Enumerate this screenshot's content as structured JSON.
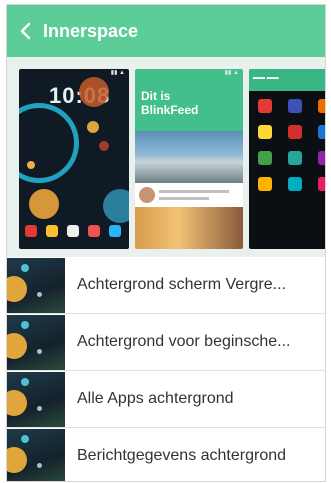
{
  "header": {
    "title": "Innerspace",
    "back_icon": "chevron-left-icon",
    "background": "#5ccc99"
  },
  "previews": {
    "lockscreen": {
      "time": "10:08"
    },
    "blinkfeed": {
      "title": "Dit is BlinkFeed"
    }
  },
  "list": {
    "items": [
      {
        "label": "Achtergrond scherm Vergre..."
      },
      {
        "label": "Achtergrond voor beginsche..."
      },
      {
        "label": "Alle Apps achtergrond"
      },
      {
        "label": "Berichtgegevens achtergrond"
      }
    ]
  }
}
